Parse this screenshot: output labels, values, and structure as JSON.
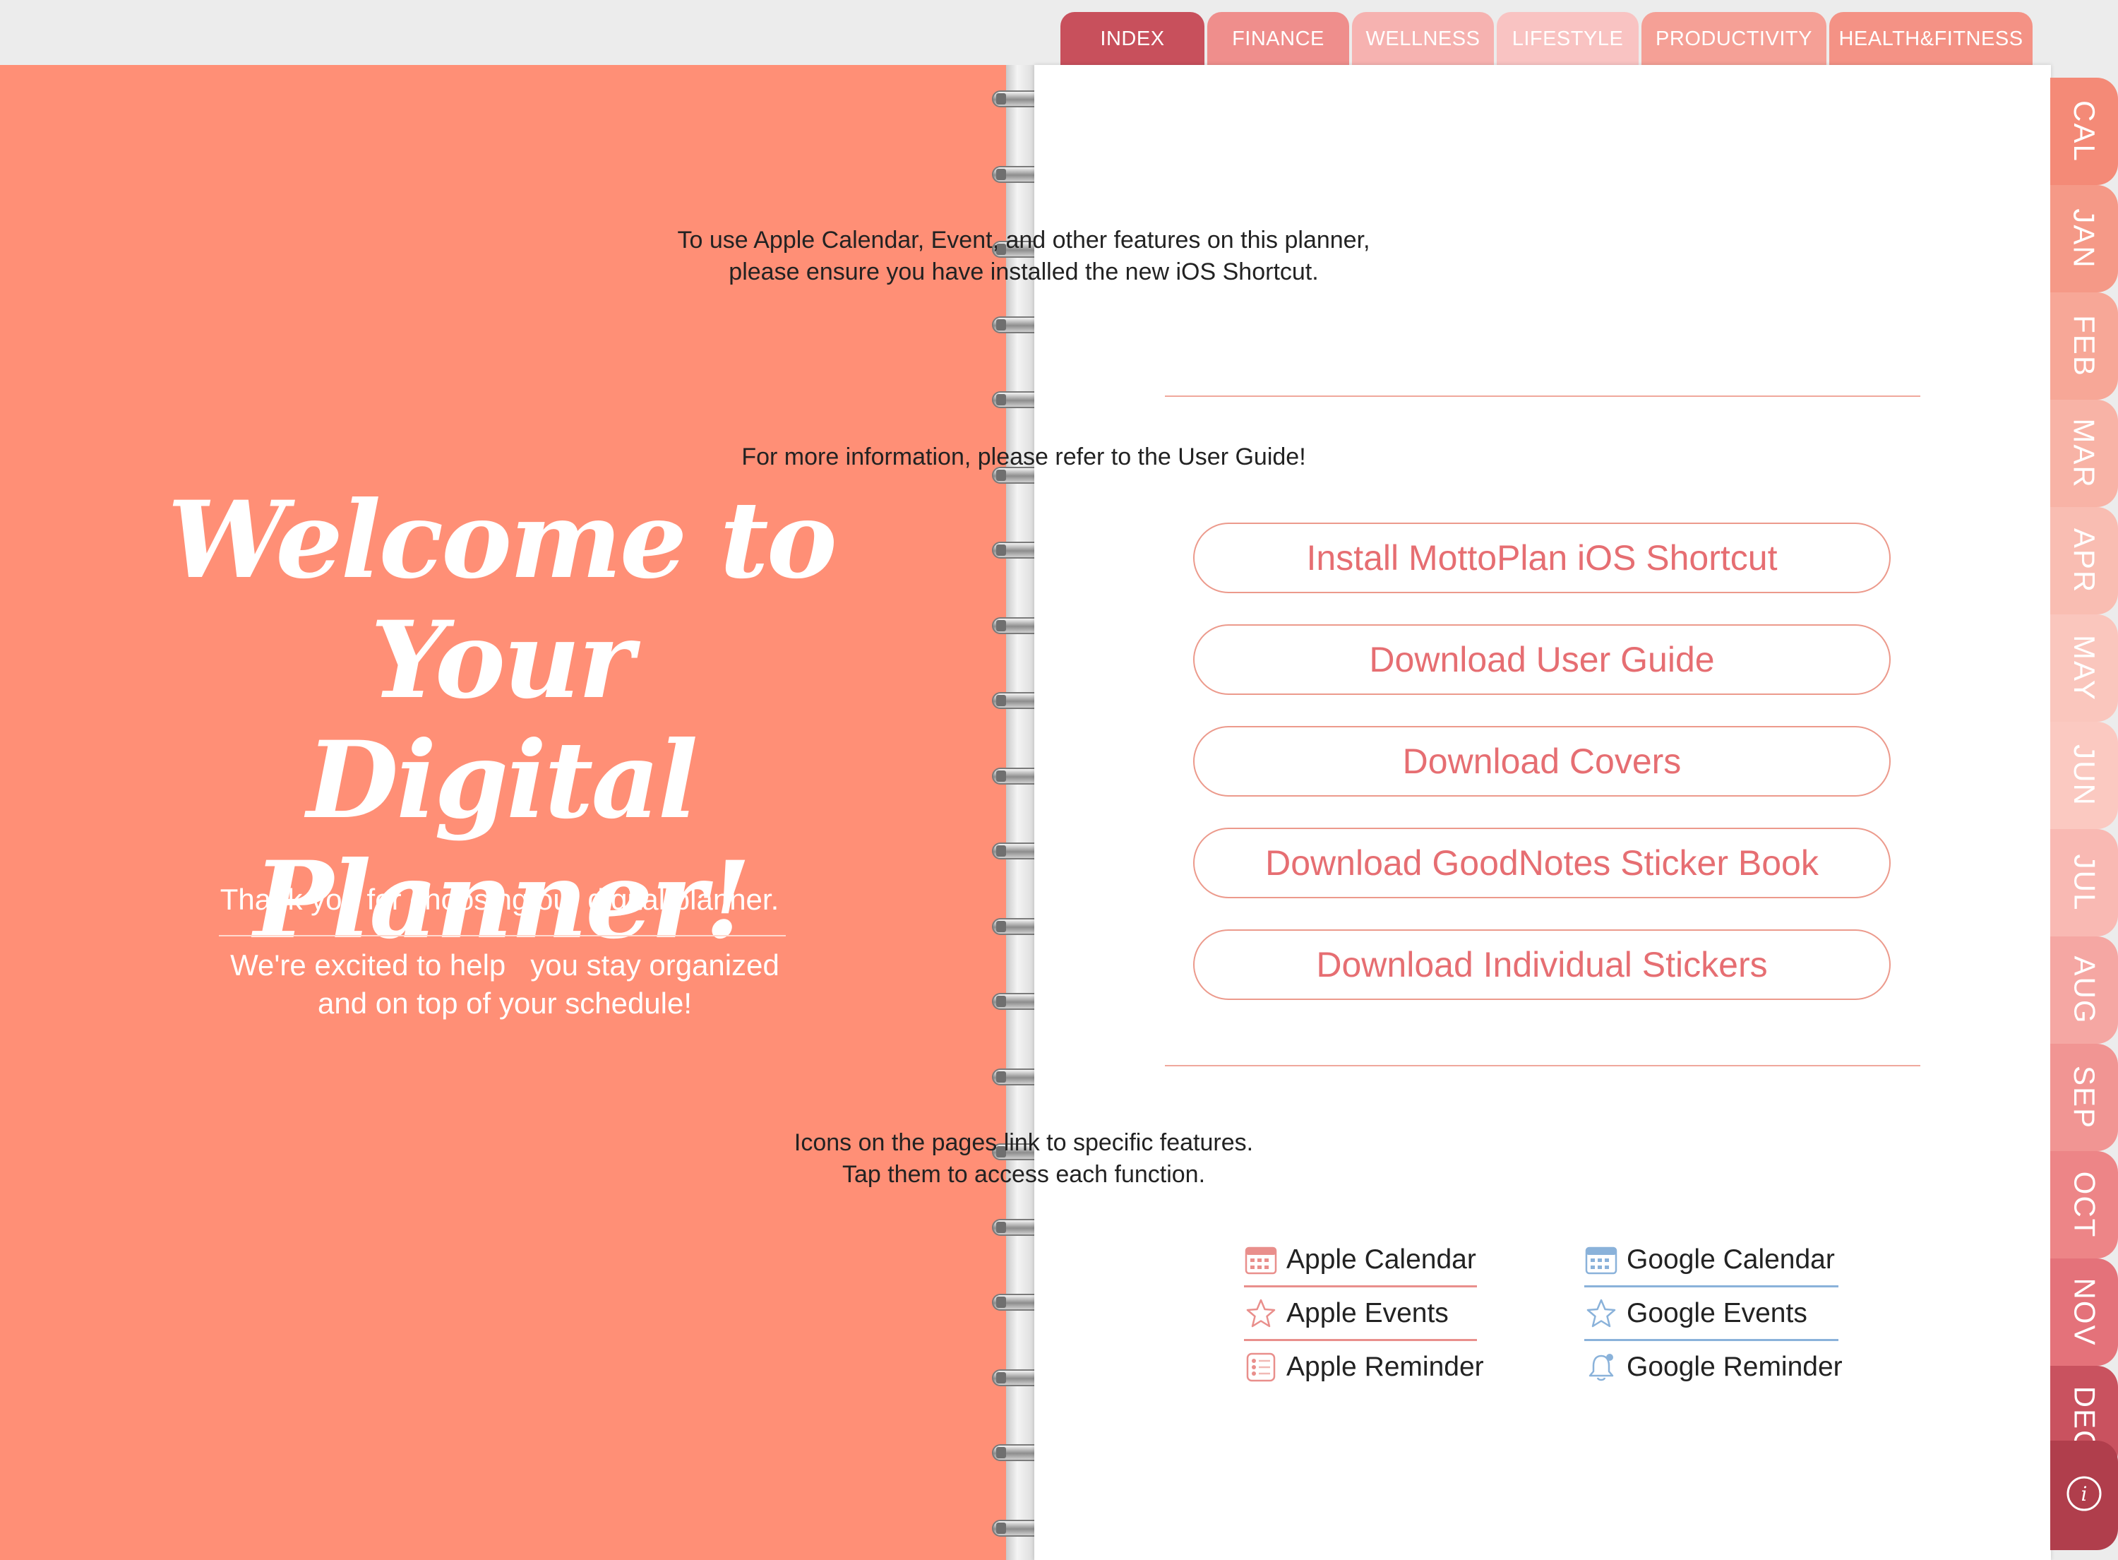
{
  "top_tabs": [
    {
      "label": "INDEX",
      "color": "#c8505c"
    },
    {
      "label": "FINANCE",
      "color": "#ef8e8c"
    },
    {
      "label": "WELLNESS",
      "color": "#f6b2b0"
    },
    {
      "label": "LIFESTYLE",
      "color": "#f9c3c2"
    },
    {
      "label": "PRODUCTIVITY",
      "color": "#f5a096"
    },
    {
      "label": "HEALTH&FITNESS",
      "color": "#f49285"
    }
  ],
  "cover": {
    "welcome_line1": "Welcome to Your",
    "welcome_line2": "Digital Planner!",
    "thanks": "Thank you for choosing our digital planner.",
    "excited_line1": "We're excited to help   you stay organized",
    "excited_line2": "and on top of your schedule!",
    "background_color": "#ff8f76"
  },
  "page": {
    "shortcut_line1": "To use Apple Calendar, Event, and other features on this planner,",
    "shortcut_line2": "please ensure you have installed the new iOS Shortcut.",
    "more_info": "For more information, please refer to the User Guide!",
    "buttons": [
      "Install MottoPlan iOS Shortcut",
      "Download User Guide",
      "Download Covers",
      "Download GoodNotes Sticker Book",
      "Download Individual Stickers"
    ],
    "icons_line1": "Icons on the pages link to specific features.",
    "icons_line2": "Tap them to access each function."
  },
  "legend": {
    "apple": [
      {
        "label": "Apple Calendar",
        "icon": "apple-calendar-icon"
      },
      {
        "label": "Apple Events",
        "icon": "apple-events-star-icon"
      },
      {
        "label": "Apple Reminder",
        "icon": "apple-reminder-list-icon"
      }
    ],
    "google": [
      {
        "label": "Google Calendar",
        "icon": "google-calendar-icon"
      },
      {
        "label": "Google Events",
        "icon": "google-events-star-icon"
      },
      {
        "label": "Google Reminder",
        "icon": "google-reminder-bell-icon"
      }
    ],
    "apple_color": "#e98f8c",
    "google_color": "#8ab2da"
  },
  "side_tabs": [
    {
      "label": "CAL",
      "color": "#f48a77"
    },
    {
      "label": "JAN",
      "color": "#f59987"
    },
    {
      "label": "FEB",
      "color": "#f7a797"
    },
    {
      "label": "MAR",
      "color": "#f8b3a6"
    },
    {
      "label": "APR",
      "color": "#f9bdb2"
    },
    {
      "label": "MAY",
      "color": "#fac6bd"
    },
    {
      "label": "JUN",
      "color": "#fbc9c1"
    },
    {
      "label": "JUL",
      "color": "#f9b9b3"
    },
    {
      "label": "AUG",
      "color": "#f5a7a3"
    },
    {
      "label": "SEP",
      "color": "#f19593"
    },
    {
      "label": "OCT",
      "color": "#ed8587"
    },
    {
      "label": "NOV",
      "color": "#e4727a"
    },
    {
      "label": "DEC",
      "color": "#c9525f"
    }
  ]
}
